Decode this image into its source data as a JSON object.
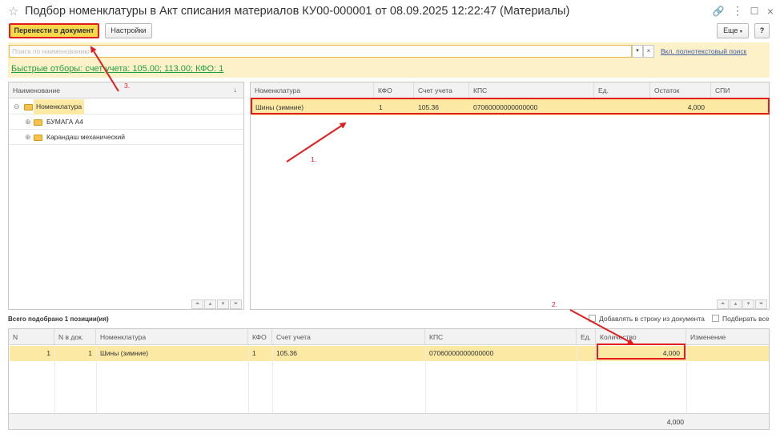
{
  "window": {
    "title": "Подбор номенклатуры в Акт списания материалов КУ00-000001 от 08.09.2025 12:22:47 (Материалы)"
  },
  "toolbar": {
    "transfer_label": "Перенести в документ",
    "settings_label": "Настройки",
    "more_label": "Еще",
    "help_label": "?"
  },
  "search": {
    "placeholder": "Поиск по наименованию",
    "fulltext_link": "Вкл. полнотекстовый поиск",
    "quick_filters": "Быстрые отборы: счет учета: 105.00; 113.00; КФО: 1"
  },
  "tree": {
    "header": "Наименование",
    "sort_icon": "↓",
    "items": [
      {
        "label": "Номенклатура",
        "level": 0,
        "selected": true
      },
      {
        "label": "БУМАГА А4",
        "level": 1,
        "selected": false
      },
      {
        "label": "Карандаш механический",
        "level": 1,
        "selected": false
      }
    ]
  },
  "list": {
    "columns": [
      "Номенклатура",
      "КФО",
      "Счет учета",
      "КПС",
      "Ед.",
      "Остаток",
      "СПИ"
    ],
    "rows": [
      {
        "name": "Шины (зимние)",
        "kfo": "1",
        "account": "105.36",
        "kps": "07060000000000000",
        "unit": "",
        "balance": "4,000",
        "spi": ""
      }
    ]
  },
  "selection": {
    "total_label": "Всего подобрано 1 позиции(ия)",
    "add_to_row_label": "Добавлять в строку из документа",
    "pick_all_label": "Подбирать все",
    "columns": [
      "N",
      "N в док.",
      "Номенклатура",
      "КФО",
      "Счет учета",
      "КПС",
      "Ед.",
      "Количество",
      "Изменение"
    ],
    "rows": [
      {
        "n": "1",
        "n_doc": "1",
        "name": "Шины (зимние)",
        "kfo": "1",
        "account": "105.36",
        "kps": "07060000000000000",
        "unit": "",
        "qty": "4,000",
        "change": ""
      }
    ],
    "footer_total": "4,000"
  },
  "annotations": {
    "step1": "1.",
    "step2": "2.",
    "step3": "3."
  },
  "colors": {
    "accent_yellow": "#f6d94a",
    "row_highlight": "#fbe9a4",
    "annotation_red": "#e21d1d",
    "filter_green": "#1f9d3f"
  }
}
